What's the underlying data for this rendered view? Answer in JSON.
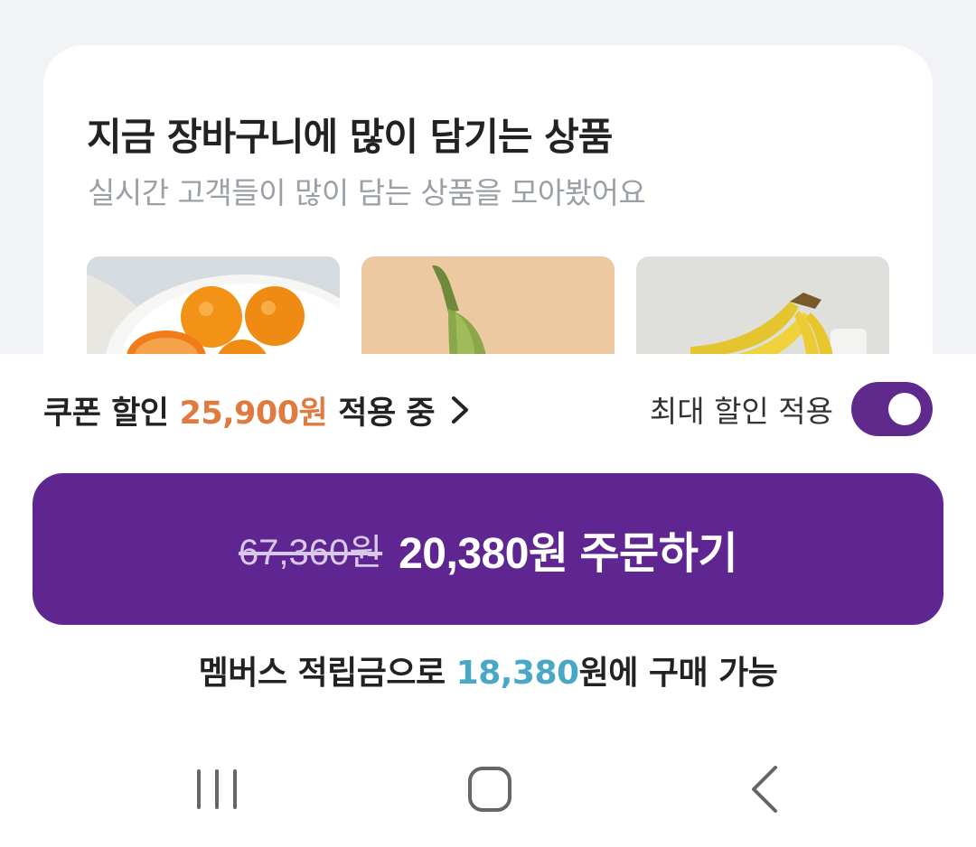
{
  "recommendation": {
    "title": "지금 장바구니에 많이 담기는 상품",
    "subtitle": "실시간 고객들이 많이 담는 상품을 모아봤어요",
    "products": [
      {
        "image": "oranges"
      },
      {
        "image": "okra"
      },
      {
        "image": "bananas"
      }
    ]
  },
  "coupon": {
    "prefix": "쿠폰 할인",
    "amount": "25,900원",
    "suffix": "적용 중",
    "chevron_icon": "chevron-right-icon"
  },
  "max_discount": {
    "label": "최대 할인 적용",
    "enabled": true
  },
  "order_button": {
    "original_price": "67,360원",
    "final_label": "20,380원 주문하기"
  },
  "points": {
    "prefix": "멤버스 적립금으로",
    "amount": "18,380",
    "suffix": "원에 구매 가능"
  },
  "navbar": {
    "recent_icon": "recent-apps-icon",
    "home_icon": "home-icon",
    "back_icon": "back-icon"
  },
  "colors": {
    "brand_purple": "#5f2590",
    "coupon_orange": "#e07a3f",
    "points_blue": "#4aa8c7"
  }
}
